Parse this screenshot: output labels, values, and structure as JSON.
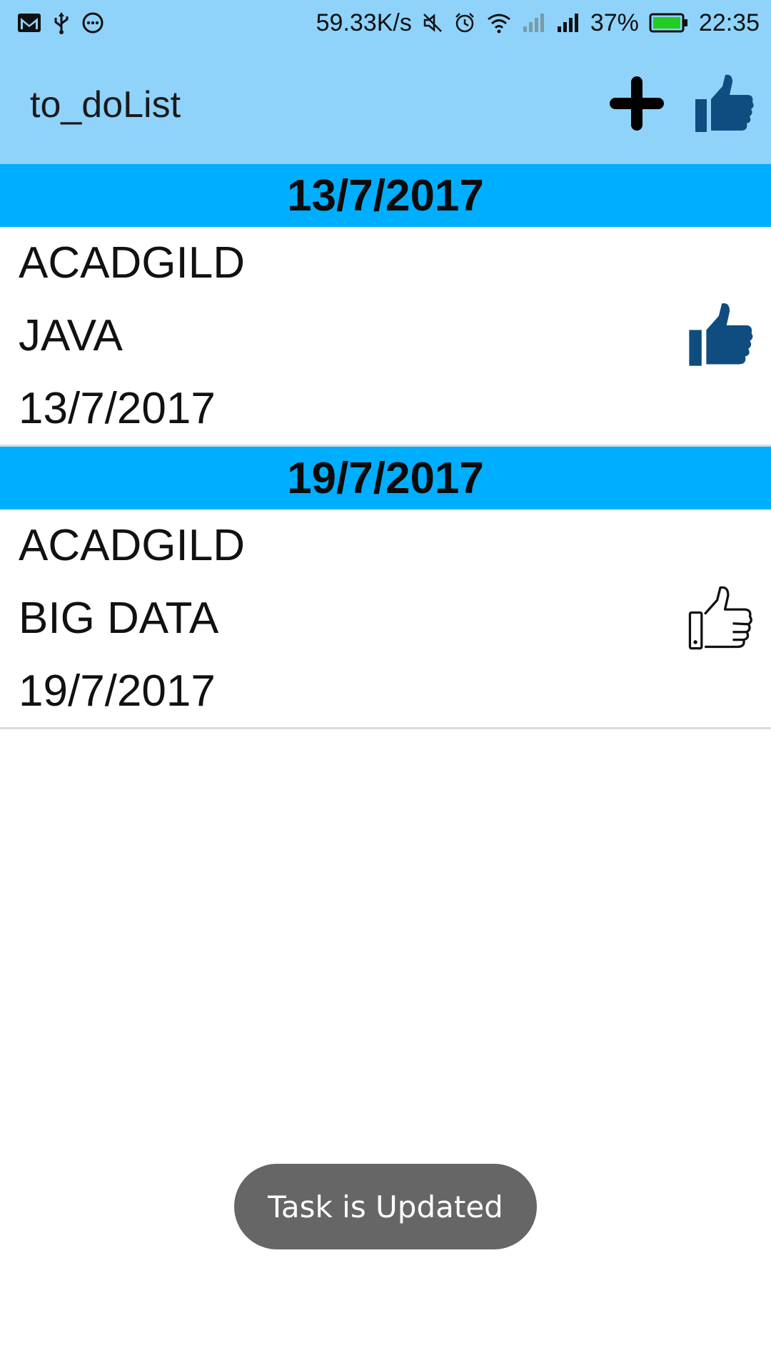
{
  "status_bar": {
    "net_speed": "59.33K/s",
    "battery": "37%",
    "time": "22:35",
    "icons_left": [
      "gmail-icon",
      "usb-icon",
      "message-icon"
    ],
    "icons_right": [
      "mute-icon",
      "alarm-icon",
      "wifi-icon",
      "signal-icon",
      "signal-icon",
      "battery-icon"
    ]
  },
  "app_bar": {
    "title": "to_doList",
    "actions": [
      "add-icon",
      "thumbs-up-icon"
    ]
  },
  "sections": [
    {
      "date": "13/7/2017",
      "items": [
        {
          "lines": [
            "ACADGILD",
            "JAVA",
            "13/7/2017"
          ],
          "liked": true
        }
      ]
    },
    {
      "date": "19/7/2017",
      "items": [
        {
          "lines": [
            "ACADGILD",
            "BIG DATA",
            "19/7/2017"
          ],
          "liked": false
        }
      ]
    }
  ],
  "toast": {
    "text": "Task is Updated"
  },
  "colors": {
    "app_bar": "#8fd3fa",
    "section_header": "#00aeff",
    "like_filled": "#0f4c80",
    "toast_bg": "#666666"
  }
}
